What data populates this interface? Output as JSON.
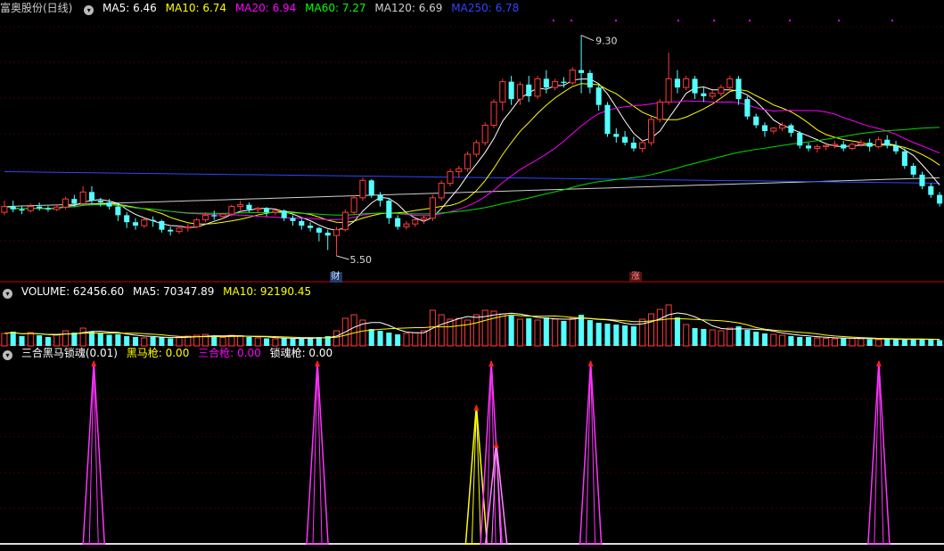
{
  "stock_title": "富奥股份(日线)",
  "ma_legend": [
    {
      "label": "MA5: 6.46",
      "color": "#ffffff"
    },
    {
      "label": "MA10: 6.74",
      "color": "#ffff00"
    },
    {
      "label": "MA20: 6.94",
      "color": "#ff00ff"
    },
    {
      "label": "MA60: 7.27",
      "color": "#00ff00"
    },
    {
      "label": "MA120: 6.69",
      "color": "#cfcfcf"
    },
    {
      "label": "MA250: 6.78",
      "color": "#3344ff"
    }
  ],
  "price_annotations": {
    "high": "9.30",
    "low": "5.50",
    "tag_finance": "财",
    "tag_rise": "涨"
  },
  "volume_legend": [
    {
      "label": "VOLUME: 62456.60",
      "color": "#ffffff"
    },
    {
      "label": "MA5: 70347.89",
      "color": "#ffffff"
    },
    {
      "label": "MA10: 92190.45",
      "color": "#ffff00"
    }
  ],
  "indicator_legend": [
    {
      "label": "三合黑马锁魂(0.01)",
      "color": "#ffffff"
    },
    {
      "label": "黑马枪: 0.00",
      "color": "#ffff00"
    },
    {
      "label": "三合枪: 0.00",
      "color": "#ff00ff"
    },
    {
      "label": "锁魂枪: 0.00",
      "color": "#ffffff"
    }
  ],
  "chart_data": {
    "type": "candlestick",
    "high_marker": 9.3,
    "low_marker": 5.5,
    "ylim": [
      5.3,
      9.6
    ],
    "candles": [
      [
        6.25,
        6.45,
        6.35,
        6.2
      ],
      [
        6.35,
        6.45,
        6.3,
        6.25
      ],
      [
        6.3,
        6.35,
        6.28,
        6.22
      ],
      [
        6.28,
        6.4,
        6.35,
        6.25
      ],
      [
        6.35,
        6.42,
        6.32,
        6.28
      ],
      [
        6.32,
        6.36,
        6.3,
        6.26
      ],
      [
        6.3,
        6.38,
        6.34,
        6.27
      ],
      [
        6.34,
        6.52,
        6.48,
        6.3
      ],
      [
        6.48,
        6.55,
        6.4,
        6.35
      ],
      [
        6.4,
        6.7,
        6.6,
        6.38
      ],
      [
        6.6,
        6.7,
        6.45,
        6.4
      ],
      [
        6.45,
        6.5,
        6.42,
        6.35
      ],
      [
        6.42,
        6.48,
        6.35,
        6.3
      ],
      [
        6.35,
        6.4,
        6.2,
        6.1
      ],
      [
        6.2,
        6.25,
        6.08,
        5.98
      ],
      [
        6.08,
        6.15,
        6.02,
        5.95
      ],
      [
        6.02,
        6.15,
        6.12,
        5.98
      ],
      [
        6.12,
        6.18,
        6.1,
        6.0
      ],
      [
        6.1,
        6.12,
        5.95,
        5.9
      ],
      [
        5.95,
        6.0,
        5.92,
        5.85
      ],
      [
        5.92,
        6.02,
        5.98,
        5.88
      ],
      [
        5.98,
        6.05,
        6.0,
        5.92
      ],
      [
        6.0,
        6.15,
        6.12,
        5.98
      ],
      [
        6.12,
        6.25,
        6.2,
        6.08
      ],
      [
        6.2,
        6.28,
        6.18,
        6.12
      ],
      [
        6.18,
        6.24,
        6.22,
        6.14
      ],
      [
        6.22,
        6.38,
        6.35,
        6.18
      ],
      [
        6.35,
        6.45,
        6.38,
        6.28
      ],
      [
        6.38,
        6.42,
        6.3,
        6.25
      ],
      [
        6.3,
        6.35,
        6.32,
        6.24
      ],
      [
        6.32,
        6.34,
        6.25,
        6.18
      ],
      [
        6.25,
        6.3,
        6.28,
        6.2
      ],
      [
        6.28,
        6.3,
        6.15,
        6.1
      ],
      [
        6.15,
        6.2,
        6.1,
        6.02
      ],
      [
        6.1,
        6.14,
        6.02,
        5.95
      ],
      [
        6.02,
        6.08,
        5.98,
        5.92
      ],
      [
        5.98,
        6.0,
        5.9,
        5.75
      ],
      [
        5.9,
        5.95,
        5.85,
        5.6
      ],
      [
        5.85,
        6.0,
        5.95,
        5.5
      ],
      [
        5.95,
        6.3,
        6.25,
        5.92
      ],
      [
        6.25,
        6.55,
        6.5,
        6.2
      ],
      [
        6.5,
        6.85,
        6.8,
        6.45
      ],
      [
        6.8,
        6.82,
        6.55,
        6.5
      ],
      [
        6.55,
        6.6,
        6.45,
        6.35
      ],
      [
        6.45,
        6.5,
        6.15,
        6.05
      ],
      [
        6.15,
        6.2,
        6.0,
        5.95
      ],
      [
        6.0,
        6.1,
        6.05,
        5.95
      ],
      [
        6.05,
        6.15,
        6.12,
        6.0
      ],
      [
        6.12,
        6.2,
        6.15,
        6.05
      ],
      [
        6.15,
        6.55,
        6.5,
        6.1
      ],
      [
        6.5,
        6.8,
        6.75,
        6.45
      ],
      [
        6.75,
        7.0,
        6.95,
        6.7
      ],
      [
        6.95,
        7.05,
        7.0,
        6.85
      ],
      [
        7.0,
        7.3,
        7.25,
        6.95
      ],
      [
        7.25,
        7.5,
        7.45,
        7.2
      ],
      [
        7.45,
        7.8,
        7.75,
        7.4
      ],
      [
        7.75,
        8.2,
        8.15,
        7.7
      ],
      [
        8.15,
        8.55,
        8.5,
        8.0
      ],
      [
        8.5,
        8.6,
        8.2,
        8.1
      ],
      [
        8.2,
        8.5,
        8.45,
        8.1
      ],
      [
        8.45,
        8.6,
        8.25,
        8.15
      ],
      [
        8.25,
        8.6,
        8.55,
        8.2
      ],
      [
        8.55,
        8.7,
        8.4,
        8.3
      ],
      [
        8.4,
        8.55,
        8.5,
        8.35
      ],
      [
        8.5,
        8.58,
        8.48,
        8.4
      ],
      [
        8.48,
        8.75,
        8.7,
        8.45
      ],
      [
        8.7,
        9.3,
        8.65,
        8.3
      ],
      [
        8.65,
        8.7,
        8.4,
        8.3
      ],
      [
        8.4,
        8.45,
        8.1,
        8.0
      ],
      [
        8.1,
        8.15,
        7.6,
        7.55
      ],
      [
        7.6,
        7.7,
        7.55,
        7.45
      ],
      [
        7.55,
        7.65,
        7.45,
        7.4
      ],
      [
        7.45,
        7.55,
        7.35,
        7.3
      ],
      [
        7.35,
        7.5,
        7.45,
        7.28
      ],
      [
        7.45,
        7.9,
        7.85,
        7.4
      ],
      [
        7.85,
        8.2,
        8.15,
        7.8
      ],
      [
        8.15,
        9.0,
        8.55,
        8.1
      ],
      [
        8.55,
        8.7,
        8.4,
        8.3
      ],
      [
        8.4,
        8.6,
        8.55,
        8.35
      ],
      [
        8.55,
        8.6,
        8.3,
        8.2
      ],
      [
        8.3,
        8.4,
        8.25,
        8.15
      ],
      [
        8.25,
        8.35,
        8.3,
        8.2
      ],
      [
        8.3,
        8.45,
        8.4,
        8.25
      ],
      [
        8.4,
        8.6,
        8.55,
        8.35
      ],
      [
        8.55,
        8.6,
        8.2,
        8.1
      ],
      [
        8.2,
        8.25,
        7.9,
        7.85
      ],
      [
        7.9,
        7.95,
        7.75,
        7.7
      ],
      [
        7.75,
        7.8,
        7.65,
        7.55
      ],
      [
        7.65,
        7.72,
        7.7,
        7.6
      ],
      [
        7.7,
        7.8,
        7.75,
        7.65
      ],
      [
        7.75,
        7.78,
        7.62,
        7.55
      ],
      [
        7.62,
        7.65,
        7.4,
        7.35
      ],
      [
        7.4,
        7.45,
        7.35,
        7.3
      ],
      [
        7.35,
        7.42,
        7.38,
        7.28
      ],
      [
        7.38,
        7.45,
        7.4,
        7.32
      ],
      [
        7.4,
        7.48,
        7.42,
        7.35
      ],
      [
        7.42,
        7.48,
        7.35,
        7.3
      ],
      [
        7.35,
        7.45,
        7.42,
        7.32
      ],
      [
        7.42,
        7.5,
        7.45,
        7.38
      ],
      [
        7.45,
        7.52,
        7.38,
        7.3
      ],
      [
        7.38,
        7.55,
        7.5,
        7.35
      ],
      [
        7.5,
        7.58,
        7.4,
        7.35
      ],
      [
        7.4,
        7.48,
        7.3,
        7.25
      ],
      [
        7.3,
        7.35,
        7.05,
        7.0
      ],
      [
        7.05,
        7.1,
        6.9,
        6.85
      ],
      [
        6.9,
        6.95,
        6.7,
        6.65
      ],
      [
        6.7,
        6.75,
        6.55,
        6.5
      ],
      [
        6.55,
        6.6,
        6.4,
        6.35
      ]
    ],
    "volumes": [
      28,
      32,
      22,
      30,
      24,
      20,
      26,
      34,
      30,
      40,
      33,
      28,
      25,
      26,
      22,
      20,
      18,
      20,
      19,
      17,
      20,
      22,
      24,
      26,
      22,
      19,
      24,
      23,
      20,
      18,
      17,
      16,
      18,
      17,
      16,
      18,
      20,
      22,
      34,
      62,
      70,
      58,
      38,
      34,
      30,
      26,
      28,
      30,
      34,
      80,
      70,
      60,
      62,
      58,
      70,
      80,
      78,
      72,
      68,
      60,
      62,
      58,
      64,
      60,
      56,
      62,
      70,
      58,
      52,
      50,
      48,
      46,
      44,
      60,
      72,
      82,
      92,
      64,
      48,
      40,
      38,
      36,
      34,
      40,
      44,
      36,
      32,
      28,
      26,
      24,
      22,
      20,
      20,
      18,
      17,
      16,
      18,
      17,
      16,
      15,
      14,
      16,
      15,
      14,
      16,
      15,
      14,
      13
    ],
    "ma_values": {
      "MA5": 6.46,
      "MA10": 6.74,
      "MA20": 6.94,
      "MA60": 7.27,
      "MA120": 6.69,
      "MA250": 6.78
    },
    "indicator_signals": [
      {
        "index": 18,
        "height": 1.0,
        "color": "#ff33ff"
      },
      {
        "index": 63,
        "height": 1.0,
        "color": "#ff33ff"
      },
      {
        "index": 95,
        "height": 0.76,
        "color": "#ffff00"
      },
      {
        "index": 98,
        "height": 1.0,
        "color": "#ff33ff"
      },
      {
        "index": 99,
        "height": 0.56,
        "color": "#ff88ff"
      },
      {
        "index": 118,
        "height": 1.0,
        "color": "#ff33ff"
      },
      {
        "index": 176,
        "height": 1.0,
        "color": "#ff33ff"
      }
    ]
  }
}
